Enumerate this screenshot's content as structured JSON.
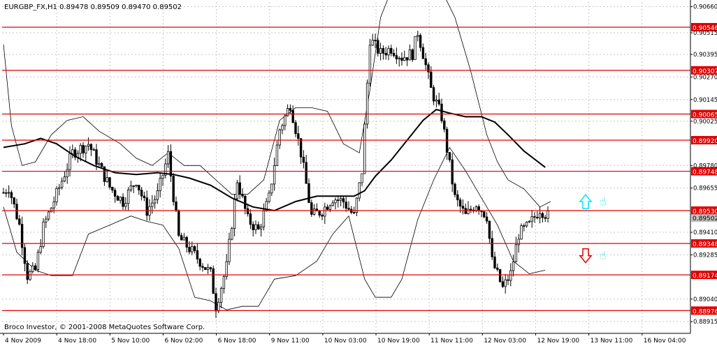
{
  "window": {
    "title": "EURGBP_FX,H1  0.89478 0.89509 0.89470 0.89502",
    "copyright": "Broco Investor, © 2001-2008 MetaQuotes Software Corp."
  },
  "colors": {
    "background": "#ffffff",
    "grid": "#c8c8c8",
    "level_line": "#e00000",
    "level_label_bg": "#e00000",
    "price_label_bg": "#c0c0c0",
    "candle": "#000000",
    "bands": "#000000",
    "ma": "#000000",
    "arrow_up": "#00e5ff",
    "arrow_down": "#e00000"
  },
  "chart_data": {
    "type": "candlestick",
    "symbol": "EURGBP_FX",
    "timeframe": "H1",
    "ohlc_header": {
      "open": 0.89478,
      "high": 0.89509,
      "low": 0.8947,
      "close": 0.89502
    },
    "y_range": [
      0.8885,
      0.90685
    ],
    "y_ticks": [
      "0.90660",
      "0.90515",
      "0.90395",
      "0.90270",
      "0.90145",
      "0.90025",
      "0.89780",
      "0.89655",
      "0.89410",
      "0.89285",
      "0.89040",
      "0.88915"
    ],
    "x_labels": [
      "4 Nov 2009",
      "4 Nov 18:00",
      "5 Nov 10:00",
      "6 Nov 02:00",
      "6 Nov 18:00",
      "9 Nov 11:00",
      "10 Nov 03:00",
      "10 Nov 19:00",
      "11 Nov 11:00",
      "12 Nov 03:00",
      "12 Nov 19:00",
      "13 Nov 11:00",
      "16 Nov 04:00"
    ],
    "levels": [
      "0.90546",
      "0.90307",
      "0.90065",
      "0.89920",
      "0.89748",
      "0.89530",
      "0.89348",
      "0.89174",
      "0.88976"
    ],
    "current_price": "0.89502",
    "close_anchors": [
      [
        0,
        0.8963
      ],
      [
        2,
        0.8966
      ],
      [
        6,
        0.8945
      ],
      [
        9,
        0.8917
      ],
      [
        12,
        0.892
      ],
      [
        15,
        0.8944
      ],
      [
        20,
        0.8962
      ],
      [
        26,
        0.8985
      ],
      [
        32,
        0.899
      ],
      [
        36,
        0.8978
      ],
      [
        40,
        0.8966
      ],
      [
        45,
        0.8958
      ],
      [
        50,
        0.897
      ],
      [
        54,
        0.8953
      ],
      [
        58,
        0.8962
      ],
      [
        62,
        0.8984
      ],
      [
        66,
        0.8938
      ],
      [
        70,
        0.8932
      ],
      [
        74,
        0.8925
      ],
      [
        78,
        0.8918
      ],
      [
        80,
        0.89
      ],
      [
        84,
        0.8922
      ],
      [
        88,
        0.897
      ],
      [
        92,
        0.8948
      ],
      [
        96,
        0.8942
      ],
      [
        100,
        0.896
      ],
      [
        104,
        0.8998
      ],
      [
        108,
        0.9012
      ],
      [
        112,
        0.8985
      ],
      [
        116,
        0.895
      ],
      [
        120,
        0.8953
      ],
      [
        124,
        0.896
      ],
      [
        128,
        0.8958
      ],
      [
        132,
        0.895
      ],
      [
        135,
        0.8975
      ],
      [
        138,
        0.9048
      ],
      [
        142,
        0.904
      ],
      [
        146,
        0.9043
      ],
      [
        150,
        0.9038
      ],
      [
        154,
        0.904
      ],
      [
        156,
        0.9052
      ],
      [
        158,
        0.904
      ],
      [
        161,
        0.902
      ],
      [
        165,
        0.9005
      ],
      [
        170,
        0.896
      ],
      [
        174,
        0.895
      ],
      [
        178,
        0.8957
      ],
      [
        182,
        0.895
      ],
      [
        184,
        0.8925
      ],
      [
        188,
        0.891
      ],
      [
        191,
        0.8918
      ],
      [
        194,
        0.894
      ],
      [
        198,
        0.8945
      ],
      [
        202,
        0.8954
      ],
      [
        205,
        0.895
      ]
    ],
    "ma_points": [
      [
        0,
        0.8988
      ],
      [
        8,
        0.899
      ],
      [
        14,
        0.8993
      ],
      [
        20,
        0.899
      ],
      [
        27,
        0.8983
      ],
      [
        34,
        0.8978
      ],
      [
        42,
        0.8974
      ],
      [
        50,
        0.8973
      ],
      [
        58,
        0.8974
      ],
      [
        64,
        0.8973
      ],
      [
        70,
        0.8971
      ],
      [
        78,
        0.8967
      ],
      [
        86,
        0.896
      ],
      [
        94,
        0.8955
      ],
      [
        102,
        0.8953
      ],
      [
        110,
        0.8958
      ],
      [
        118,
        0.8961
      ],
      [
        126,
        0.8961
      ],
      [
        132,
        0.8961
      ],
      [
        136,
        0.8964
      ],
      [
        140,
        0.8972
      ],
      [
        146,
        0.8981
      ],
      [
        152,
        0.8992
      ],
      [
        158,
        0.9003
      ],
      [
        163,
        0.9009
      ],
      [
        168,
        0.9007
      ],
      [
        174,
        0.9005
      ],
      [
        180,
        0.9005
      ],
      [
        185,
        0.9002
      ],
      [
        190,
        0.8995
      ],
      [
        196,
        0.8986
      ],
      [
        204,
        0.8977
      ]
    ],
    "band_upper": [
      [
        0,
        0.9045
      ],
      [
        3,
        0.9
      ],
      [
        7,
        0.8978
      ],
      [
        12,
        0.898
      ],
      [
        18,
        0.8995
      ],
      [
        24,
        0.9003
      ],
      [
        30,
        0.9005
      ],
      [
        36,
        0.8997
      ],
      [
        44,
        0.899
      ],
      [
        50,
        0.8982
      ],
      [
        56,
        0.8978
      ],
      [
        62,
        0.8985
      ],
      [
        68,
        0.8978
      ],
      [
        74,
        0.8978
      ],
      [
        80,
        0.897
      ],
      [
        86,
        0.8962
      ],
      [
        92,
        0.8962
      ],
      [
        98,
        0.897
      ],
      [
        104,
        0.9003
      ],
      [
        110,
        0.901
      ],
      [
        116,
        0.901
      ],
      [
        122,
        0.9008
      ],
      [
        128,
        0.899
      ],
      [
        134,
        0.8985
      ],
      [
        138,
        0.902
      ],
      [
        142,
        0.906
      ],
      [
        146,
        0.9075
      ],
      [
        150,
        0.9078
      ],
      [
        155,
        0.907
      ],
      [
        160,
        0.9075
      ],
      [
        165,
        0.9075
      ],
      [
        170,
        0.906
      ],
      [
        176,
        0.903
      ],
      [
        182,
        0.8995
      ],
      [
        186,
        0.898
      ],
      [
        190,
        0.897
      ],
      [
        196,
        0.8965
      ],
      [
        202,
        0.8955
      ],
      [
        206,
        0.8958
      ]
    ],
    "band_lower": [
      [
        0,
        0.8955
      ],
      [
        5,
        0.893
      ],
      [
        12,
        0.892
      ],
      [
        18,
        0.8917
      ],
      [
        26,
        0.8917
      ],
      [
        32,
        0.894
      ],
      [
        40,
        0.8945
      ],
      [
        48,
        0.895
      ],
      [
        54,
        0.8947
      ],
      [
        60,
        0.8945
      ],
      [
        66,
        0.8932
      ],
      [
        72,
        0.8905
      ],
      [
        78,
        0.8903
      ],
      [
        84,
        0.8898
      ],
      [
        90,
        0.89
      ],
      [
        96,
        0.89
      ],
      [
        102,
        0.8915
      ],
      [
        110,
        0.8917
      ],
      [
        118,
        0.8925
      ],
      [
        124,
        0.894
      ],
      [
        130,
        0.895
      ],
      [
        136,
        0.8915
      ],
      [
        140,
        0.8905
      ],
      [
        146,
        0.8905
      ],
      [
        150,
        0.8915
      ],
      [
        156,
        0.8948
      ],
      [
        162,
        0.897
      ],
      [
        168,
        0.8988
      ],
      [
        174,
        0.8975
      ],
      [
        180,
        0.896
      ],
      [
        186,
        0.8945
      ],
      [
        192,
        0.8925
      ],
      [
        198,
        0.8918
      ],
      [
        204,
        0.892
      ]
    ],
    "signals": [
      {
        "type": "up",
        "color": "#00e5ff",
        "label": "buy",
        "bar": 200,
        "price": 0.8958
      },
      {
        "type": "down",
        "color": "#e00000",
        "label": "sell",
        "bar": 200,
        "price": 0.8928
      }
    ]
  }
}
